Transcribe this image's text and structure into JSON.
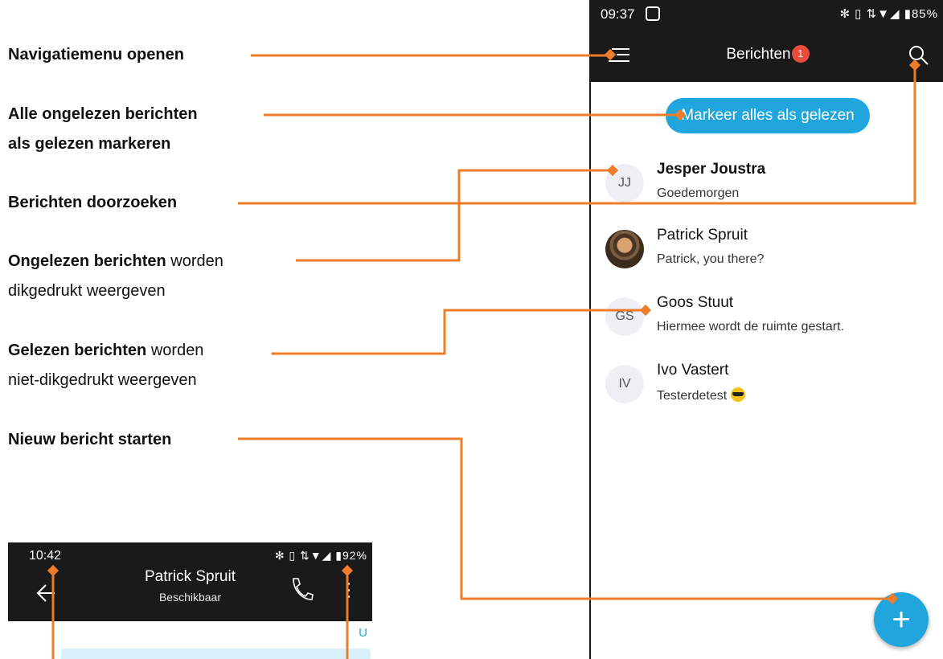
{
  "annotations": [
    {
      "bold": "Navigatiemenu openen",
      "rest": ""
    },
    {
      "bold": "Alle ongelezen berichten",
      "rest": ""
    },
    {
      "bold": "als gelezen markeren",
      "rest": ""
    },
    {
      "bold": "Berichten doorzoeken",
      "rest": ""
    },
    {
      "bold": "Ongelezen berichten",
      "rest": " worden"
    },
    {
      "bold": "",
      "rest": "dikgedrukt weergeven"
    },
    {
      "bold": "Gelezen berichten",
      "rest": " worden"
    },
    {
      "bold": "",
      "rest": "niet-dikgedrukt weergeven"
    },
    {
      "bold": "Nieuw bericht starten",
      "rest": ""
    }
  ],
  "main_phone": {
    "status_time": "09:37",
    "status_right": "✻ ▯ ⇅▼◢ ▮85%",
    "title": "Berichten",
    "badge_count": "1",
    "mark_all_label": "Markeer alles als gelezen",
    "conversations": [
      {
        "initials": "JJ",
        "name": "Jesper Joustra",
        "preview": "Goedemorgen",
        "unread": true
      },
      {
        "initials": "",
        "name": "Patrick Spruit",
        "preview": "Patrick, you there?",
        "unread": false
      },
      {
        "initials": "GS",
        "name": "Goos Stuut",
        "preview": "Hiermee wordt de ruimte gestart.",
        "unread": false
      },
      {
        "initials": "IV",
        "name": "Ivo Vastert",
        "preview": "Testerdetest",
        "unread": false
      }
    ],
    "fab_label": "+"
  },
  "chat_phone": {
    "status_time": "10:42",
    "status_right": "✻ ▯ ⇅▼◢ ▮92%",
    "contact_name": "Patrick Spruit",
    "contact_status": "Beschikbaar",
    "partial_text": "U"
  },
  "colors": {
    "accent": "#20a5dc",
    "annotation_line": "#ee7d2b",
    "appbar": "#1a1a1a",
    "badge": "#e74c3c"
  }
}
